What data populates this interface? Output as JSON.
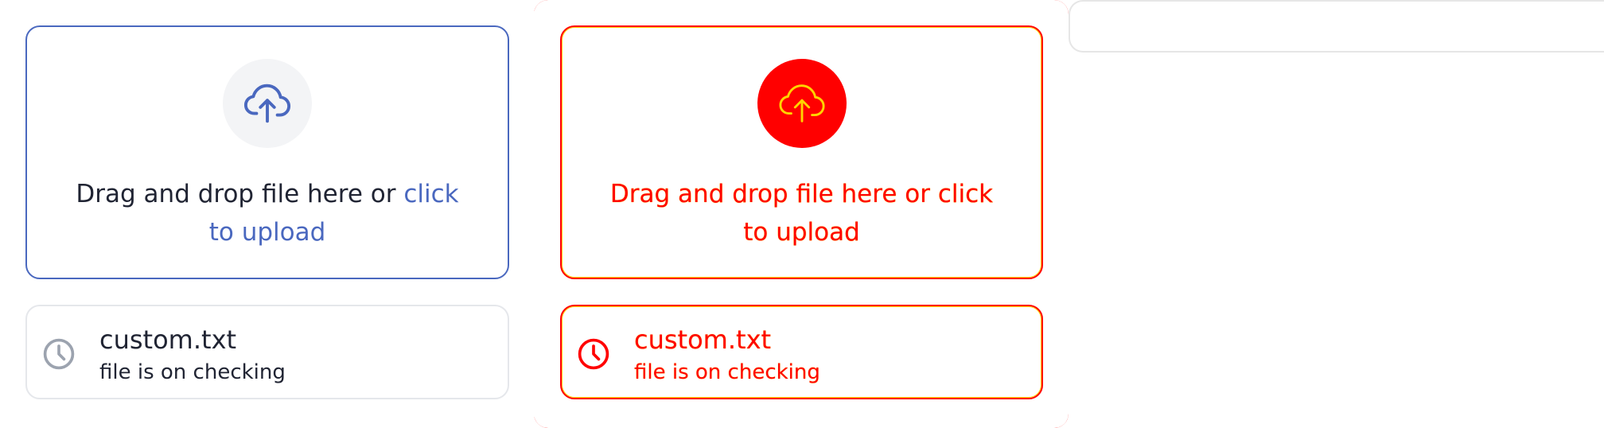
{
  "colors": {
    "accent": "#4a68bf",
    "text": "#202433",
    "border": "#e5e7eb",
    "icon_bg": "#f3f4f6",
    "error": "#ff0000",
    "error_outline": "#ffd400"
  },
  "default_state": {
    "dropzone": {
      "icon": "cloud-upload-icon",
      "text": "Drag and drop file here or ",
      "link": "click to upload"
    },
    "file": {
      "icon": "clock-icon",
      "name": "custom.txt",
      "status": "file is on checking"
    }
  },
  "error_state": {
    "dropzone": {
      "icon": "cloud-upload-icon",
      "text": "Drag and drop file here or ",
      "link": "click to upload"
    },
    "file": {
      "icon": "clock-icon",
      "name": "custom.txt",
      "status": "file is on checking"
    }
  }
}
